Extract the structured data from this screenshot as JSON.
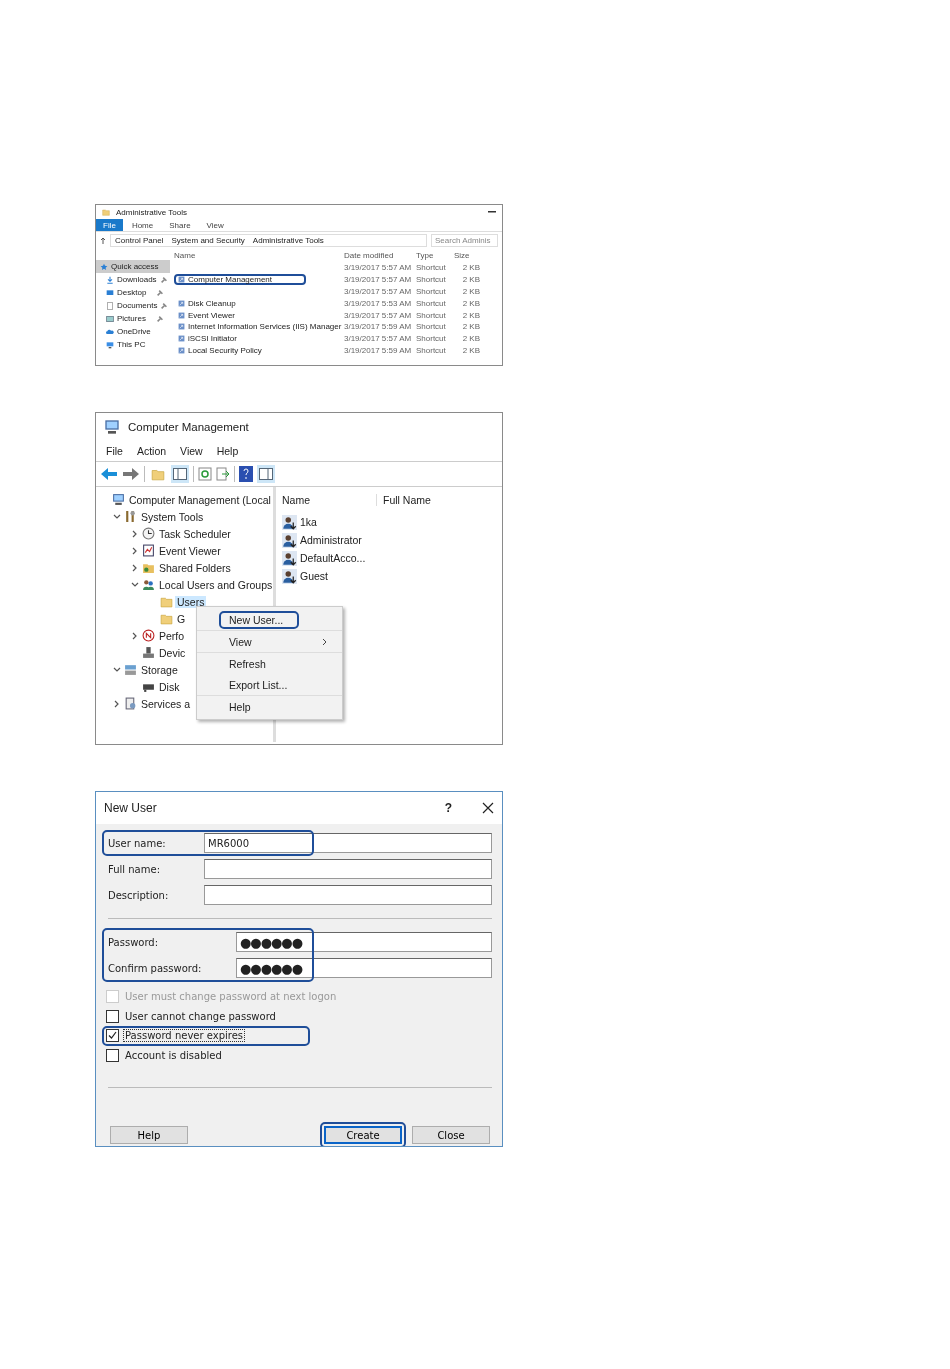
{
  "explorer": {
    "title": "Administrative Tools",
    "ribbon_tabs": [
      {
        "label": "File",
        "kind": "menu"
      },
      {
        "label": "Home",
        "kind": "tab"
      },
      {
        "label": "Share",
        "kind": "tab"
      },
      {
        "label": "View",
        "kind": "tab"
      }
    ],
    "breadcrumb": [
      "Control Panel",
      "System and Security",
      "Administrative Tools"
    ],
    "search": {
      "placeholder": "Search Adminis"
    },
    "nav": [
      {
        "label": "Quick access",
        "selected": true,
        "pinned": false
      },
      {
        "label": "Downloads",
        "selected": false,
        "pinned": true
      },
      {
        "label": "Desktop",
        "selected": false,
        "pinned": true
      },
      {
        "label": "Documents",
        "selected": false,
        "pinned": true
      },
      {
        "label": "Pictures",
        "selected": false,
        "pinned": true
      },
      {
        "label": "OneDrive",
        "selected": false,
        "pinned": false
      },
      {
        "label": "This PC",
        "selected": false,
        "pinned": false
      }
    ],
    "columns": [
      "Name",
      "Date modified",
      "Type",
      "Size"
    ],
    "rows": [
      {
        "date": "3/19/2017 5:57 AM",
        "type": "Shortcut",
        "size": "2 KB",
        "highlighted": false
      },
      {
        "name": "Computer Management",
        "date": "3/19/2017 5:57 AM",
        "type": "Shortcut",
        "size": "2 KB",
        "highlighted": true
      },
      {
        "date": "3/19/2017 5:57 AM",
        "type": "Shortcut",
        "size": "2 KB",
        "highlighted": false
      },
      {
        "name": "Disk Cleanup",
        "date": "3/19/2017 5:53 AM",
        "type": "Shortcut",
        "size": "2 KB",
        "highlighted": false
      },
      {
        "name": "Event Viewer",
        "date": "3/19/2017 5:57 AM",
        "type": "Shortcut",
        "size": "2 KB",
        "highlighted": false
      },
      {
        "name": "Internet Information Services (IIS) Manager",
        "date": "3/19/2017 5:59 AM",
        "type": "Shortcut",
        "size": "2 KB",
        "highlighted": false
      },
      {
        "name": "iSCSI Initiator",
        "date": "3/19/2017 5:57 AM",
        "type": "Shortcut",
        "size": "2 KB",
        "highlighted": false
      },
      {
        "name": "Local Security Policy",
        "date": "3/19/2017 5:59 AM",
        "type": "Shortcut",
        "size": "2 KB",
        "highlighted": false
      }
    ]
  },
  "management": {
    "title": "Computer Management",
    "menu": [
      "File",
      "Action",
      "View",
      "Help"
    ],
    "tree": [
      {
        "label": "Computer Management (Local",
        "selected": false,
        "children": [
          {
            "label": "System Tools",
            "expanded": true,
            "selected": false,
            "children": [
              {
                "label": "Task Scheduler",
                "expanded": false,
                "selected": false
              },
              {
                "label": "Event Viewer",
                "expanded": false,
                "selected": false
              },
              {
                "label": "Shared Folders",
                "expanded": false,
                "selected": false
              },
              {
                "label": "Local Users and Groups",
                "expanded": true,
                "selected": false,
                "children": [
                  {
                    "label": "Users",
                    "selected": true
                  },
                  {
                    "label": "G",
                    "selected": false
                  }
                ]
              },
              {
                "label": "Perfo",
                "expanded": false,
                "selected": false
              },
              {
                "label": "Devic",
                "selected": false
              }
            ]
          },
          {
            "label": "Storage",
            "expanded": true,
            "selected": false,
            "children": [
              {
                "label": "Disk",
                "selected": false
              }
            ]
          },
          {
            "label": "Services a",
            "expanded": false,
            "selected": false
          }
        ]
      }
    ],
    "columns": [
      "Name",
      "Full Name"
    ],
    "users": [
      "1ka",
      "Administrator",
      "DefaultAcco...",
      "Guest"
    ],
    "context_menu": {
      "groups": [
        [
          {
            "label": "New User...",
            "highlighted": true,
            "submenu": false
          }
        ],
        [
          {
            "label": "View",
            "highlighted": false,
            "submenu": true
          }
        ],
        [
          {
            "label": "Refresh",
            "highlighted": false,
            "submenu": false
          },
          {
            "label": "Export List...",
            "highlighted": false,
            "submenu": false
          }
        ],
        [
          {
            "label": "Help",
            "highlighted": false,
            "submenu": false
          }
        ]
      ]
    }
  },
  "dialog": {
    "title": "New User",
    "help_label": "?",
    "fields": [
      {
        "label": "User name:",
        "value": "MR6000",
        "highlighted": true
      },
      {
        "label": "Full name:",
        "highlighted": false
      },
      {
        "label": "Description:",
        "highlighted": false
      }
    ],
    "password_group": {
      "highlighted": true,
      "fields": [
        {
          "label": "Password:",
          "value": "●●●●●●"
        },
        {
          "label": "Confirm password:",
          "value": "●●●●●●"
        }
      ]
    },
    "options": [
      {
        "label": "User must change password at next logon",
        "checked": false,
        "disabled": true,
        "focused": false,
        "highlighted": false
      },
      {
        "label": "User cannot change password",
        "checked": false,
        "disabled": false,
        "focused": false,
        "highlighted": false
      },
      {
        "label": "Password never expires",
        "checked": true,
        "disabled": false,
        "focused": true,
        "highlighted": true
      },
      {
        "label": "Account is disabled",
        "checked": false,
        "disabled": false,
        "focused": false,
        "highlighted": false
      }
    ],
    "buttons": [
      {
        "label": "Help",
        "default": false,
        "highlighted": false
      },
      {
        "label": "Create",
        "default": true,
        "highlighted": true
      },
      {
        "label": "Close",
        "default": false,
        "highlighted": false
      }
    ]
  }
}
